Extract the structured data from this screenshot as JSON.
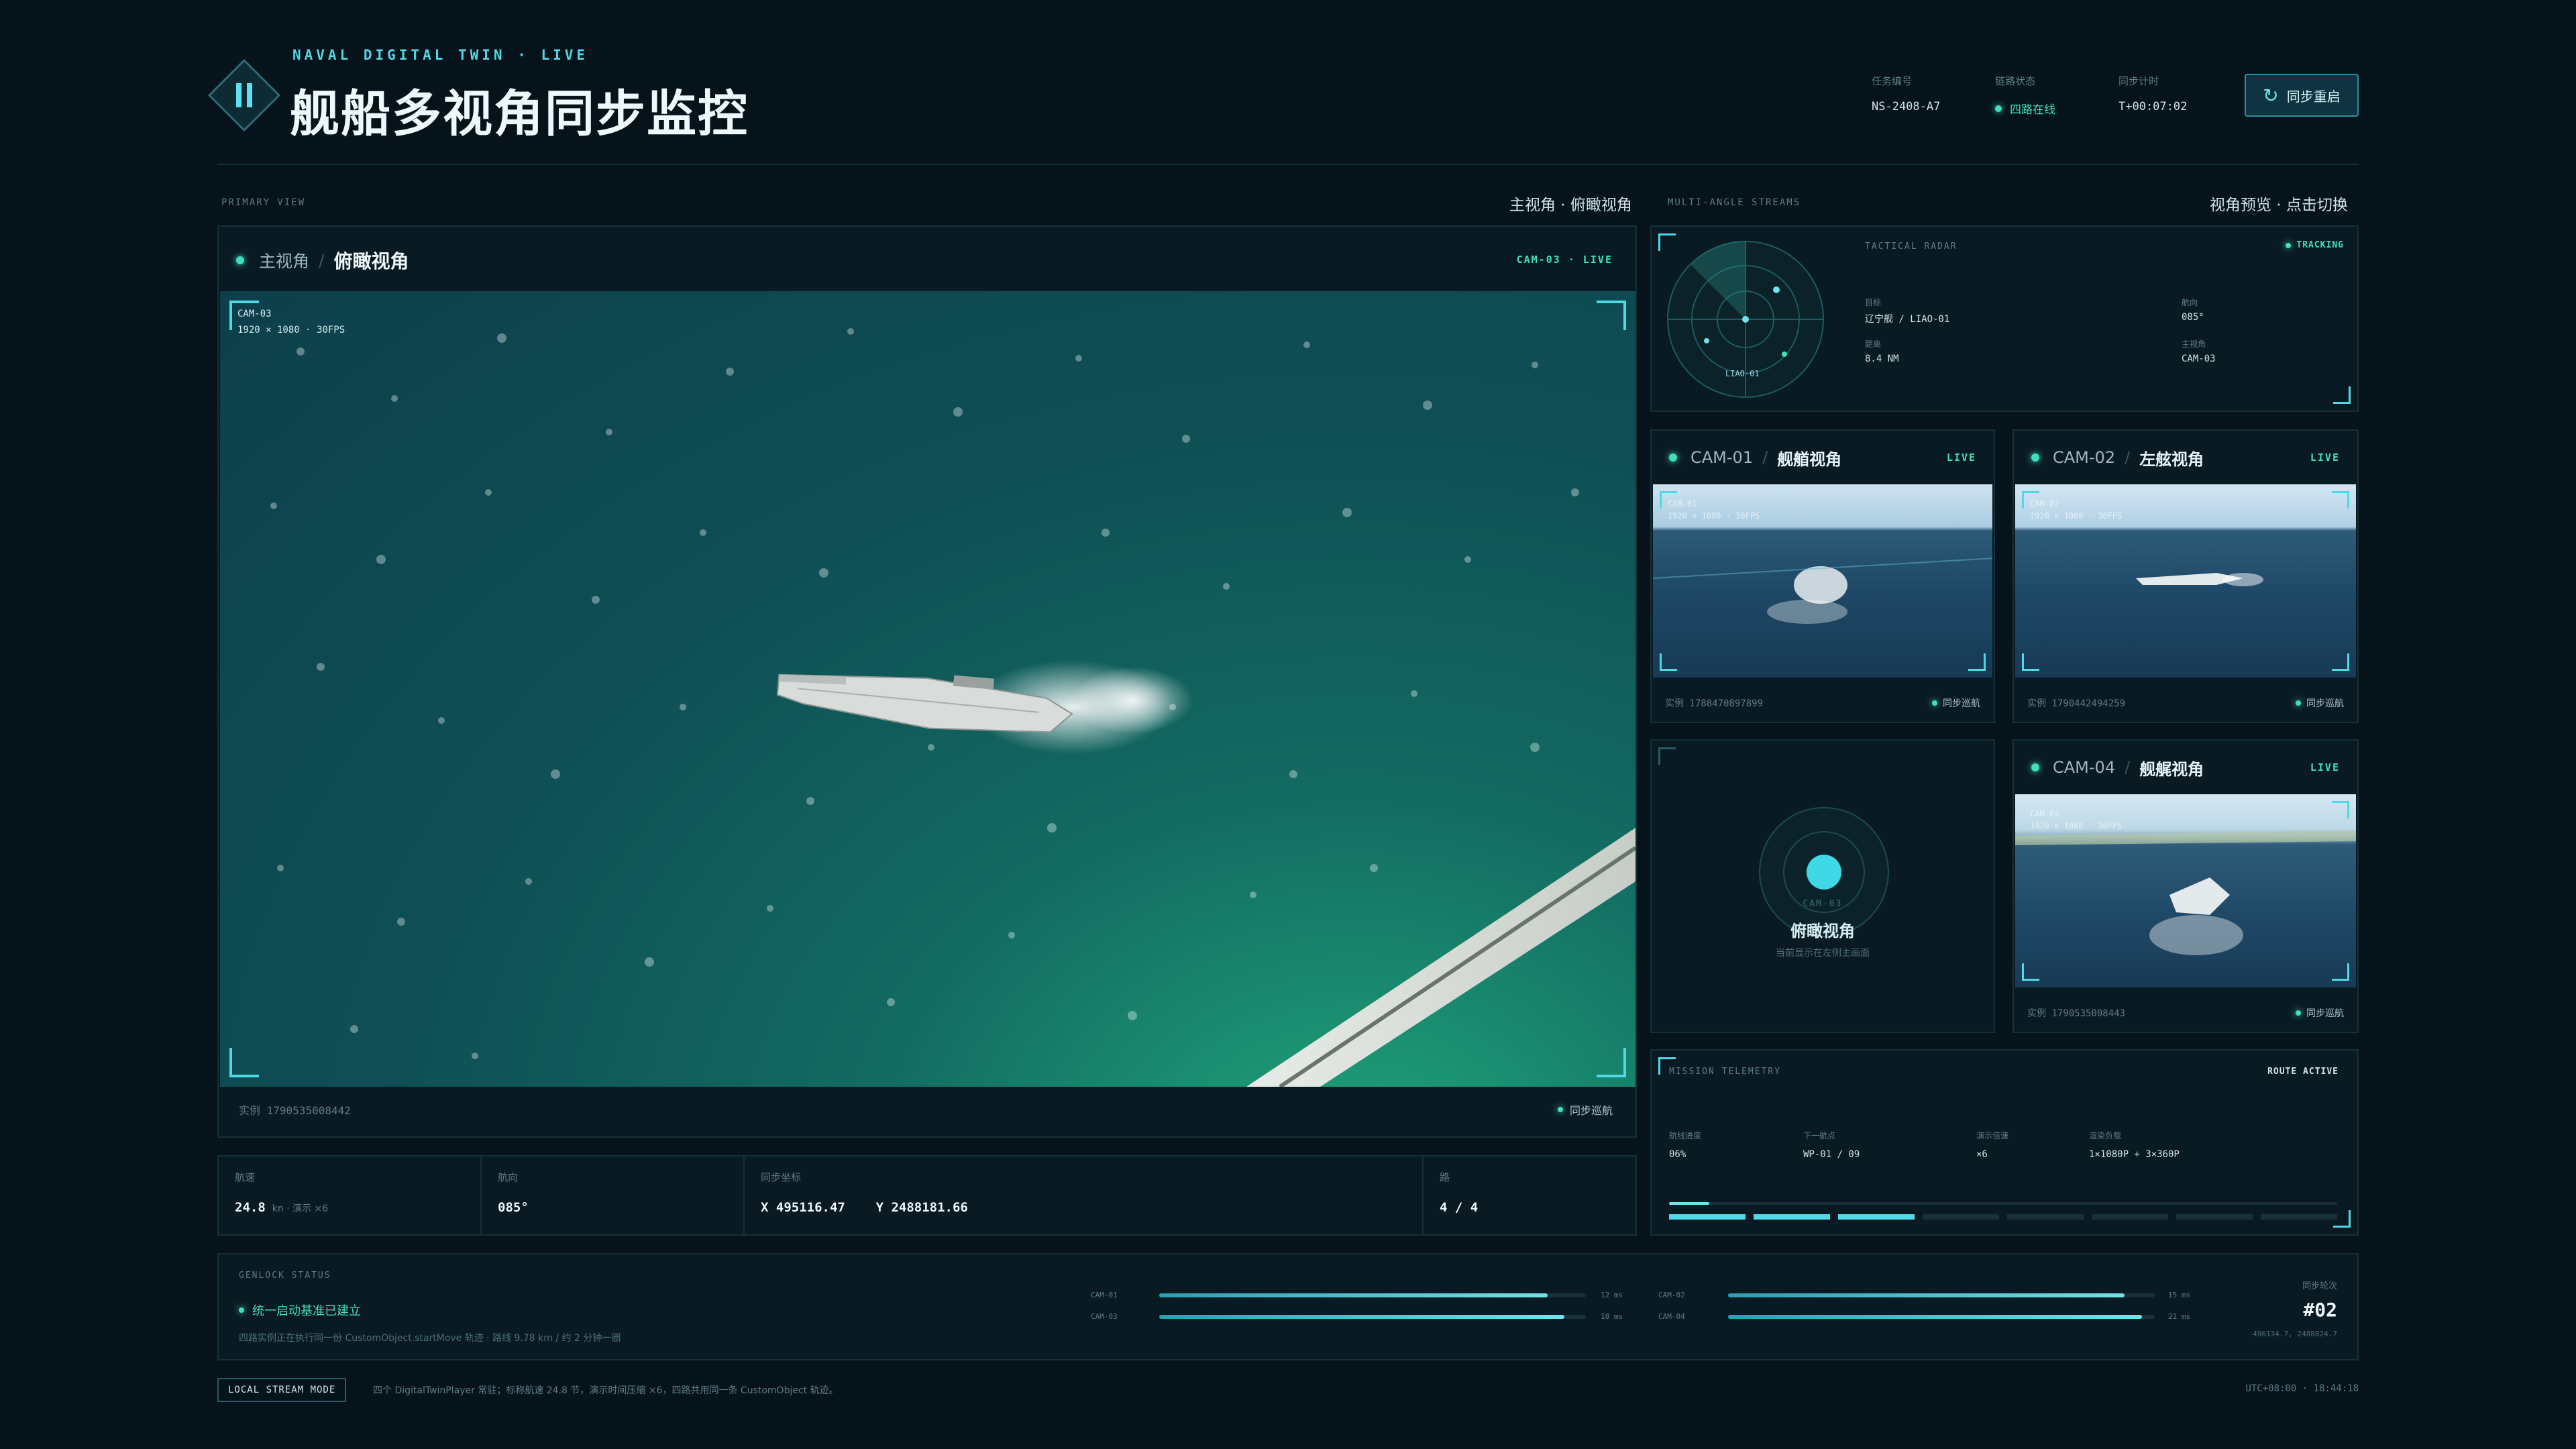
{
  "header": {
    "kicker": "NAVAL DIGITAL TWIN · LIVE",
    "title": "舰船多视角同步监控",
    "mission_label": "任务编号",
    "mission_value": "NS-2408-A7",
    "link_label": "链路状态",
    "link_value": "四路在线",
    "sync_label": "同步计时",
    "sync_value": "T+00:07:02",
    "resync_button": "同步重启"
  },
  "primary": {
    "section_label": "PRIMARY VIEW",
    "section_right": "主视角 · 俯瞰视角",
    "crumb_main": "主视角",
    "crumb_view": "俯瞰视角",
    "cam_tag": "CAM-03 · LIVE",
    "overlay_cam": "CAM-03",
    "overlay_res": "1920 × 1080 · 30FPS",
    "instance": "实例 1790535008442",
    "sync_status": "同步巡航"
  },
  "stats": [
    {
      "label": "航速",
      "value": "24.8",
      "unit": "kn · 演示 ×6"
    },
    {
      "label": "航向",
      "value": "085°",
      "unit": ""
    },
    {
      "label": "同步坐标",
      "value": "X 495116.47    Y 2488181.66",
      "unit": ""
    },
    {
      "label": "路",
      "value": "4 / 4",
      "unit": ""
    }
  ],
  "multi": {
    "section_label": "MULTI-ANGLE STREAMS",
    "section_right": "视角预览 · 点击切换"
  },
  "radar": {
    "title": "TACTICAL RADAR",
    "status": "TRACKING",
    "center_label": "LIAO-01",
    "fields": [
      {
        "label": "目标",
        "value": "辽宁舰 / LIAO-01"
      },
      {
        "label": "航向",
        "value": "085°"
      },
      {
        "label": "距离",
        "value": "8.4 NM"
      },
      {
        "label": "主视角",
        "value": "CAM-03"
      }
    ]
  },
  "cams": [
    {
      "id": "CAM-01",
      "name": "舰艏视角",
      "live": "LIVE",
      "instance": "实例 1788470897899",
      "sync": "同步巡航",
      "overlay": "CAM-01",
      "overlay_res": "1920 × 1080 · 30FPS"
    },
    {
      "id": "CAM-02",
      "name": "左舷视角",
      "live": "LIVE",
      "instance": "实例 1790442494259",
      "sync": "同步巡航",
      "overlay": "CAM-02",
      "overlay_res": "1920 × 1080 · 30FPS"
    },
    {
      "id": "CAM-04",
      "name": "舰艉视角",
      "live": "LIVE",
      "instance": "实例 1790535008443",
      "sync": "同步巡航",
      "overlay": "CAM-04",
      "overlay_res": "1920 × 1080 · 30FPS"
    }
  ],
  "placeholder": {
    "cam": "CAM-03",
    "title": "俯瞰视角",
    "note": "当前显示在左侧主画面"
  },
  "telemetry": {
    "title": "MISSION TELEMETRY",
    "status": "ROUTE ACTIVE",
    "fields": [
      {
        "label": "航线进度",
        "value": "06%"
      },
      {
        "label": "下一航点",
        "value": "WP-01 / 09"
      },
      {
        "label": "演示倍速",
        "value": "×6"
      },
      {
        "label": "渲染负载",
        "value": "1×1080P + 3×360P"
      }
    ],
    "progress": 0.06,
    "segments_total": 8,
    "segments_active": 3
  },
  "genlock": {
    "title": "GENLOCK STATUS",
    "status": "统一启动基准已建立",
    "note": "四路实例正在执行同一份 CustomObject.startMove 轨迹 · 路线 9.78 km / 约 2 分钟一圈",
    "bars": [
      {
        "name": "CAM-01",
        "ms": "12 ms",
        "fill": 0.91
      },
      {
        "name": "CAM-03",
        "ms": "18 ms",
        "fill": 0.95
      },
      {
        "name": "CAM-02",
        "ms": "15 ms",
        "fill": 0.93
      },
      {
        "name": "CAM-04",
        "ms": "21 ms",
        "fill": 0.97
      }
    ],
    "round_label": "同步轮次",
    "round_value": "#02",
    "round_coords": "496134.7, 2488824.7"
  },
  "footer": {
    "mode": "LOCAL STREAM MODE",
    "note": "四个 DigitalTwinPlayer 常驻；标称航速 24.8 节，演示时间压缩 ×6，四路共用同一条 CustomObject 轨迹。",
    "clock": "UTC+08:00 · 18:44:18"
  },
  "colors": {
    "accent": "#3ee0c0",
    "cyan": "#4fd8e6",
    "bg": "#07131a"
  }
}
